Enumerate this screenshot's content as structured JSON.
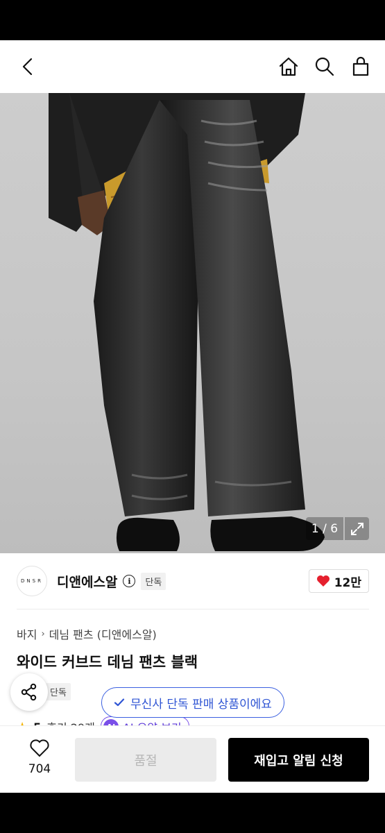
{
  "header": {
    "back_icon": "chevron-left-icon",
    "home_icon": "home-icon",
    "search_icon": "search-icon",
    "cart_icon": "shopping-bag-icon"
  },
  "gallery": {
    "counter": "1 / 6",
    "expand_icon": "expand-icon"
  },
  "brand": {
    "logo_text": "DNSR",
    "name": "디앤에스알",
    "info_icon_glyph": "i",
    "exclusive_label": "단독",
    "like_count": "12만",
    "like_color": "#e5202e"
  },
  "breadcrumb": {
    "category": "바지",
    "subcategory": "데님 팬츠 (디앤에스알)"
  },
  "product": {
    "title": "와이드 커브드 데님 팬츠 블랙",
    "exclusive_label": "단독"
  },
  "toast": {
    "text": "무신사 단독 판매 상품이에요",
    "accent": "#2f55d4"
  },
  "rating": {
    "score": "5",
    "reviews": "후기 29개",
    "ai_badge": "AI",
    "ai_summary": "AI 요약 보기"
  },
  "bottom_bar": {
    "wish_count": "704",
    "soldout_label": "품절",
    "restock_label": "재입고 알림 신청"
  }
}
